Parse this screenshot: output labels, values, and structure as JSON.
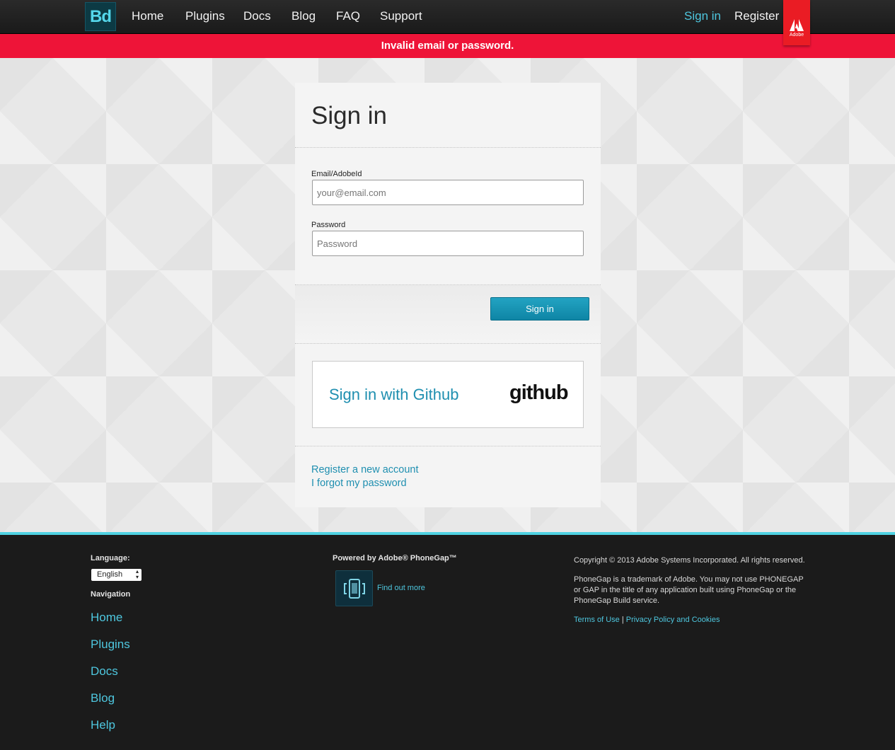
{
  "header": {
    "logo_text": "Bd",
    "nav": [
      "Home",
      "Plugins",
      "Docs",
      "Blog",
      "FAQ",
      "Support"
    ],
    "signin_label": "Sign in",
    "register_label": "Register",
    "adobe_label": "Adobe"
  },
  "alert": {
    "message": "Invalid email or password."
  },
  "signin": {
    "title": "Sign in",
    "email_label": "Email/AdobeId",
    "email_placeholder": "your@email.com",
    "password_label": "Password",
    "password_placeholder": "Password",
    "submit_label": "Sign in",
    "github_label": "Sign in with Github",
    "github_logo": "github",
    "register_link": "Register a new account",
    "forgot_link": "I forgot my password"
  },
  "footer": {
    "language_heading": "Language:",
    "language_value": "English",
    "navigation_heading": "Navigation",
    "nav": [
      "Home",
      "Plugins",
      "Docs",
      "Blog",
      "Help"
    ],
    "powered_by": "Powered by Adobe® PhoneGap™",
    "find_out_more": "Find out more",
    "copyright": "Copyright © 2013 Adobe Systems Incorporated. All rights reserved.",
    "trademark": "PhoneGap is a trademark of Adobe. You may not use PHONEGAP or GAP in the title of any application built using PhoneGap or the PhoneGap Build service.",
    "terms_link": "Terms of Use",
    "separator": "|",
    "privacy_link": "Privacy Policy and Cookies"
  },
  "colors": {
    "accent": "#4ec7df",
    "alert": "#ee1438",
    "adobe_red": "#ea1c24",
    "button": "#1594b4"
  },
  "icons": [
    "adobe-logo-icon",
    "phonegap-icon",
    "github-logo",
    "select-arrows-icon"
  ]
}
